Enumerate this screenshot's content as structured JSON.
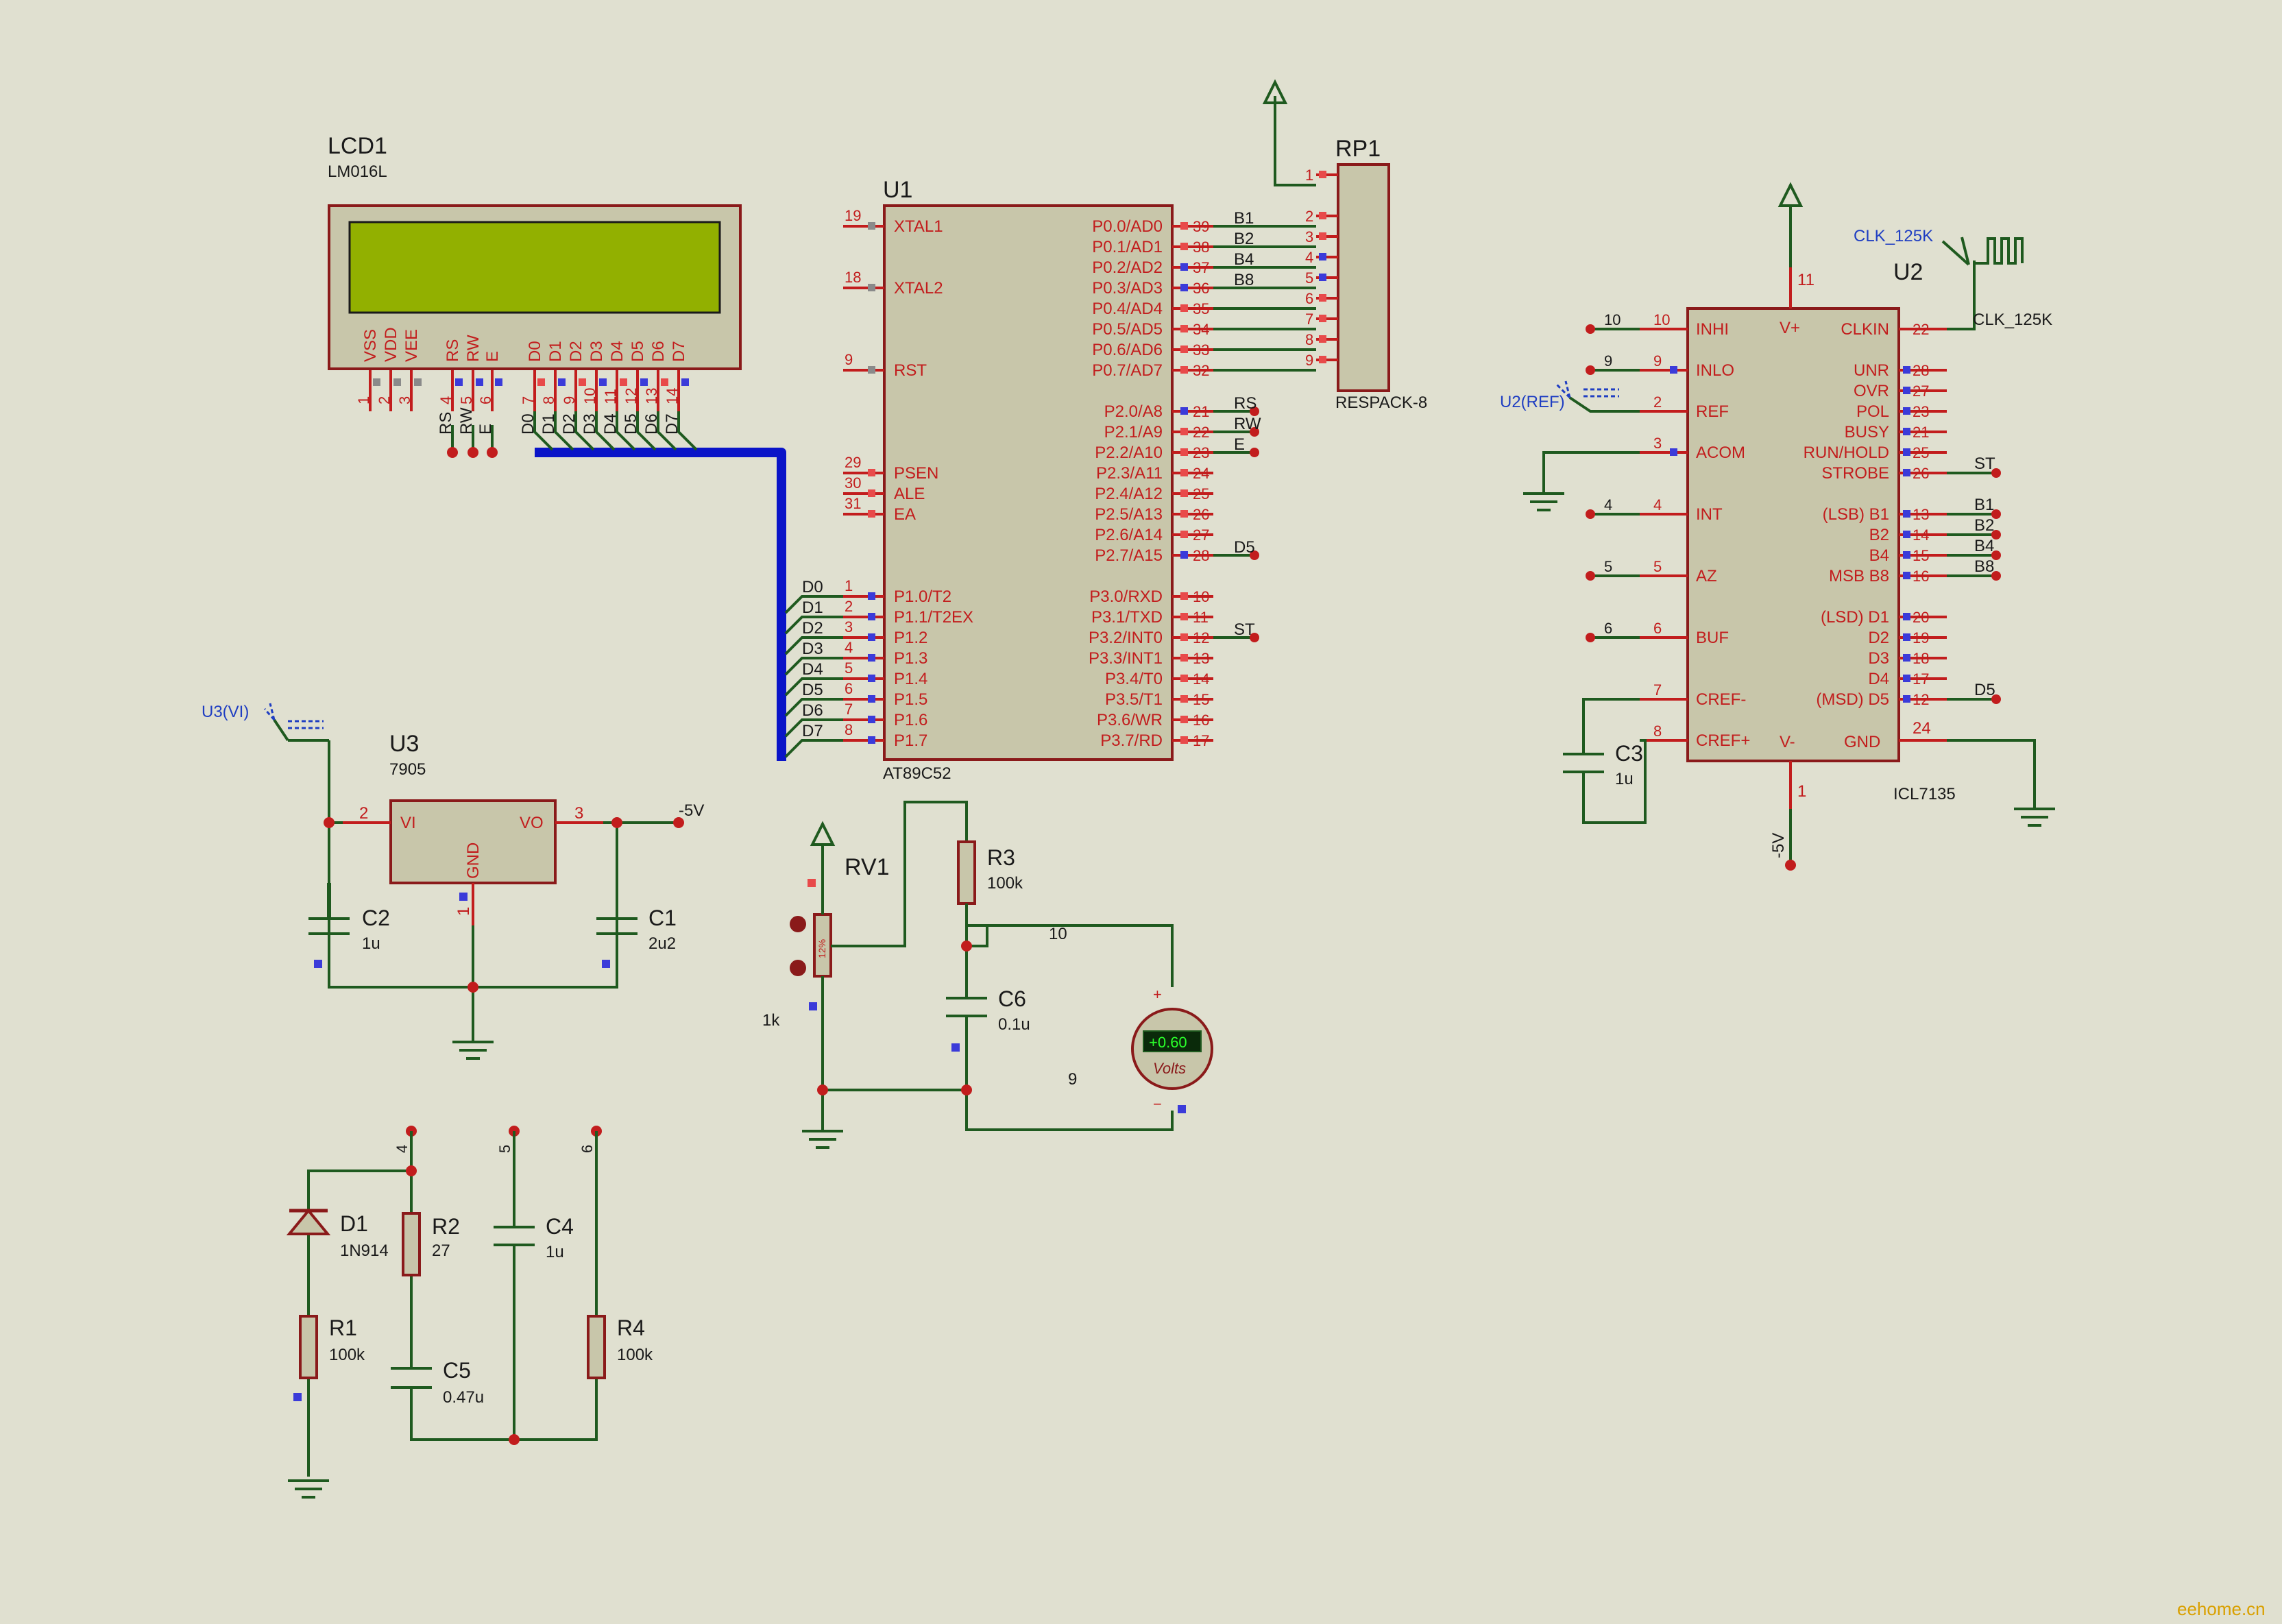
{
  "lcd1": {
    "ref": "LCD1",
    "part": "LM016L",
    "pin_labels": [
      "VSS",
      "VDD",
      "VEE",
      "RS",
      "RW",
      "E",
      "D0",
      "D1",
      "D2",
      "D3",
      "D4",
      "D5",
      "D6",
      "D7"
    ],
    "pin_numbers": [
      "1",
      "2",
      "3",
      "4",
      "5",
      "6",
      "7",
      "8",
      "9",
      "10",
      "11",
      "12",
      "13",
      "14"
    ],
    "net_labels": [
      "RS",
      "RW",
      "E",
      "D0",
      "D1",
      "D2",
      "D3",
      "D4",
      "D5",
      "D6",
      "D7"
    ],
    "screen_color": "#92b000"
  },
  "u1": {
    "ref": "U1",
    "part": "AT89C52",
    "left_pins": [
      {
        "num": "19",
        "name": "XTAL1"
      },
      {
        "num": "18",
        "name": "XTAL2"
      },
      {
        "num": "9",
        "name": "RST"
      },
      {
        "num": "29",
        "name": "PSEN"
      },
      {
        "num": "30",
        "name": "ALE"
      },
      {
        "num": "31",
        "name": "EA"
      },
      {
        "num": "1",
        "name": "P1.0/T2"
      },
      {
        "num": "2",
        "name": "P1.1/T2EX"
      },
      {
        "num": "3",
        "name": "P1.2"
      },
      {
        "num": "4",
        "name": "P1.3"
      },
      {
        "num": "5",
        "name": "P1.4"
      },
      {
        "num": "6",
        "name": "P1.5"
      },
      {
        "num": "7",
        "name": "P1.6"
      },
      {
        "num": "8",
        "name": "P1.7"
      }
    ],
    "right_pins": [
      {
        "num": "39",
        "name": "P0.0/AD0"
      },
      {
        "num": "38",
        "name": "P0.1/AD1"
      },
      {
        "num": "37",
        "name": "P0.2/AD2"
      },
      {
        "num": "36",
        "name": "P0.3/AD3"
      },
      {
        "num": "35",
        "name": "P0.4/AD4"
      },
      {
        "num": "34",
        "name": "P0.5/AD5"
      },
      {
        "num": "33",
        "name": "P0.6/AD6"
      },
      {
        "num": "32",
        "name": "P0.7/AD7"
      },
      {
        "num": "21",
        "name": "P2.0/A8"
      },
      {
        "num": "22",
        "name": "P2.1/A9"
      },
      {
        "num": "23",
        "name": "P2.2/A10"
      },
      {
        "num": "24",
        "name": "P2.3/A11"
      },
      {
        "num": "25",
        "name": "P2.4/A12"
      },
      {
        "num": "26",
        "name": "P2.5/A13"
      },
      {
        "num": "27",
        "name": "P2.6/A14"
      },
      {
        "num": "28",
        "name": "P2.7/A15"
      },
      {
        "num": "10",
        "name": "P3.0/RXD"
      },
      {
        "num": "11",
        "name": "P3.1/TXD"
      },
      {
        "num": "12",
        "name": "P3.2/INT0"
      },
      {
        "num": "13",
        "name": "P3.3/INT1"
      },
      {
        "num": "14",
        "name": "P3.4/T0"
      },
      {
        "num": "15",
        "name": "P3.5/T1"
      },
      {
        "num": "16",
        "name": "P3.6/WR"
      },
      {
        "num": "17",
        "name": "P3.7/RD"
      }
    ],
    "p1_nets": [
      "D0",
      "D1",
      "D2",
      "D3",
      "D4",
      "D5",
      "D6",
      "D7"
    ],
    "p0_nets": [
      "B1",
      "B2",
      "B4",
      "B8"
    ],
    "p2_nets": [
      "RS",
      "RW",
      "E",
      "D5"
    ],
    "p3_nets": [
      "ST"
    ]
  },
  "rp1": {
    "ref": "RP1",
    "part": "RESPACK-8",
    "pin_numbers": [
      "1",
      "2",
      "3",
      "4",
      "5",
      "6",
      "7",
      "8",
      "9"
    ]
  },
  "u2": {
    "ref": "U2",
    "part": "ICL7135",
    "left_pins": [
      {
        "num": "10",
        "name": "INHI"
      },
      {
        "num": "9",
        "name": "INLO"
      },
      {
        "num": "2",
        "name": "REF"
      },
      {
        "num": "3",
        "name": "ACOM"
      },
      {
        "num": "4",
        "name": "INT"
      },
      {
        "num": "5",
        "name": "AZ"
      },
      {
        "num": "6",
        "name": "BUF"
      },
      {
        "num": "7",
        "name": "CREF-"
      },
      {
        "num": "8",
        "name": "CREF+"
      }
    ],
    "left_nets": [
      "10",
      "9",
      "4",
      "5",
      "6"
    ],
    "top_pin": {
      "num": "11",
      "name": "V+"
    },
    "bottom_pins": [
      {
        "num": "1",
        "name": "V-"
      },
      {
        "num": "24",
        "name": "GND"
      }
    ],
    "right_pins": [
      {
        "num": "22",
        "name": "CLKIN"
      },
      {
        "num": "28",
        "name": "UNR"
      },
      {
        "num": "27",
        "name": "OVR"
      },
      {
        "num": "23",
        "name": "POL"
      },
      {
        "num": "21",
        "name": "BUSY"
      },
      {
        "num": "25",
        "name": "RUN/HOLD"
      },
      {
        "num": "26",
        "name": "STROBE"
      },
      {
        "num": "13",
        "name": "(LSB)  B1"
      },
      {
        "num": "14",
        "name": "B2"
      },
      {
        "num": "15",
        "name": "B4"
      },
      {
        "num": "16",
        "name": "MSB  B8"
      },
      {
        "num": "20",
        "name": "(LSD)  D1"
      },
      {
        "num": "19",
        "name": "D2"
      },
      {
        "num": "18",
        "name": "D3"
      },
      {
        "num": "17",
        "name": "D4"
      },
      {
        "num": "12",
        "name": "(MSD)  D5"
      }
    ],
    "right_nets": [
      "ST",
      "B1",
      "B2",
      "B4",
      "B8",
      "D5"
    ],
    "clock_net": "CLK_125K",
    "clock_generator": "CLK_125K",
    "ref_terminal": "U2(REF)",
    "vminus_net": "-5V"
  },
  "c3": {
    "ref": "C3",
    "value": "1u"
  },
  "u3": {
    "ref": "U3",
    "part": "7905",
    "pins": [
      {
        "num": "2",
        "name": "VI"
      },
      {
        "num": "3",
        "name": "VO"
      },
      {
        "num": "1",
        "name": "GND"
      }
    ],
    "input_terminal": "U3(VI)",
    "output_net": "-5V"
  },
  "c2": {
    "ref": "C2",
    "value": "1u"
  },
  "c1": {
    "ref": "C1",
    "value": "2u2"
  },
  "rv1": {
    "ref": "RV1",
    "value": "1k",
    "position": "12%"
  },
  "r3": {
    "ref": "R3",
    "value": "100k"
  },
  "c6": {
    "ref": "C6",
    "value": "0.1u"
  },
  "voltmeter": {
    "reading": "+0.60",
    "unit": "Volts",
    "plus": "+",
    "minus": "−",
    "net_top": "10",
    "net_bottom": "9"
  },
  "d1": {
    "ref": "D1",
    "value": "1N914"
  },
  "r2": {
    "ref": "R2",
    "value": "27"
  },
  "c4": {
    "ref": "C4",
    "value": "1u"
  },
  "r1": {
    "ref": "R1",
    "value": "100k"
  },
  "c5": {
    "ref": "C5",
    "value": "0.47u"
  },
  "r4": {
    "ref": "R4",
    "value": "100k"
  },
  "bottom_nets": [
    "4",
    "5",
    "6"
  ],
  "watermark": "eehome.cn"
}
